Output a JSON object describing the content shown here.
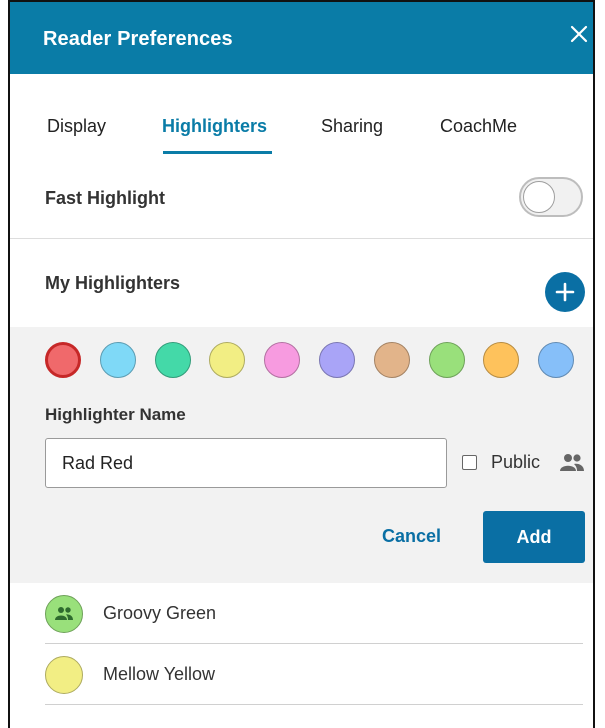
{
  "dialog": {
    "title": "Reader Preferences"
  },
  "tabs": [
    {
      "label": "Display"
    },
    {
      "label": "Highlighters"
    },
    {
      "label": "Sharing"
    },
    {
      "label": "CoachMe"
    }
  ],
  "active_tab": "Highlighters",
  "fast_highlight": {
    "label": "Fast Highlight",
    "enabled": false
  },
  "my_highlighters": {
    "label": "My Highlighters"
  },
  "editor": {
    "colors": [
      "#f0696b",
      "#7fd9f7",
      "#44d9a8",
      "#f2ee84",
      "#f79be0",
      "#a9a4f7",
      "#e2b48a",
      "#99e07b",
      "#fec25c",
      "#86bff9"
    ],
    "selected_color": "#f0696b",
    "name_label": "Highlighter Name",
    "name_value": "Rad Red",
    "public_label": "Public",
    "public_checked": false,
    "cancel_label": "Cancel",
    "add_label": "Add"
  },
  "highlighters": [
    {
      "name": "Groovy Green",
      "color": "#99e07b",
      "shared": true
    },
    {
      "name": "Mellow Yellow",
      "color": "#f2ee84",
      "shared": false
    }
  ],
  "colors": {
    "accent": "#0a7ca7",
    "button": "#0a6fa4"
  }
}
